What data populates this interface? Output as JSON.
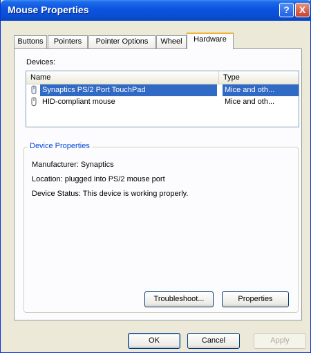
{
  "window": {
    "title": "Mouse Properties"
  },
  "title_buttons": {
    "help": "?",
    "close": "X"
  },
  "tabs": [
    {
      "label": "Buttons"
    },
    {
      "label": "Pointers"
    },
    {
      "label": "Pointer Options"
    },
    {
      "label": "Wheel"
    },
    {
      "label": "Hardware"
    }
  ],
  "active_tab": "Hardware",
  "devices": {
    "label": "Devices:",
    "columns": [
      "Name",
      "Type"
    ],
    "rows": [
      {
        "name": "Synaptics PS/2 Port TouchPad",
        "type": "Mice and oth...",
        "selected": true
      },
      {
        "name": "HID-compliant mouse",
        "type": "Mice and oth...",
        "selected": false
      }
    ]
  },
  "device_properties": {
    "title": "Device Properties",
    "manufacturer": "Manufacturer: Synaptics",
    "location": "Location: plugged into PS/2 mouse port",
    "status": "Device Status: This device is working properly."
  },
  "panel_buttons": {
    "troubleshoot": "Troubleshoot...",
    "properties": "Properties"
  },
  "dialog_buttons": {
    "ok": "OK",
    "cancel": "Cancel",
    "apply": "Apply"
  },
  "colors": {
    "title_bar": "#0a54e0",
    "selection": "#316ac5",
    "group_title": "#0046d5",
    "active_tab_accent": "#f2b233"
  }
}
